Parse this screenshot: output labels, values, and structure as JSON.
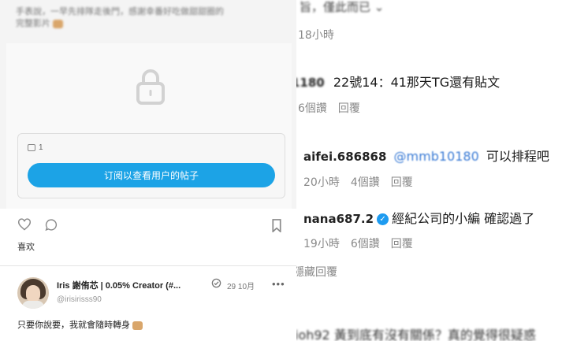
{
  "left": {
    "blurred_text": [
      "手表說，一早先排隊走後門，感謝幸番好吃做甜甜圈的",
      "完整影片"
    ],
    "subscribe": {
      "image_count": "1",
      "button_label": "订阅以查看用户的帖子"
    },
    "likes_label": "喜欢",
    "post": {
      "author": "Iris 謝侑芯 | 0.05% Creator (#...",
      "date": "29 10月",
      "handle": "@irisirisss90",
      "body": "只要你說要，我就會隨時轉身"
    }
  },
  "right": {
    "top_partial": "旨，僅此而已 ⌄",
    "top_time": "18小時",
    "comment1": {
      "user": "1180",
      "text": "22號14：41那天TG還有貼文",
      "likes": "6個讚",
      "reply": "回覆"
    },
    "comment2": {
      "user": "aifei.686868",
      "mention": "@mmb10180",
      "text": "可以排程吧",
      "time": "20小時",
      "likes": "4個讚",
      "reply": "回覆"
    },
    "comment3": {
      "user": "nana687.2",
      "text": "經紀公司的小編 確認過了",
      "time": "19小時",
      "likes": "6個讚",
      "reply": "回覆"
    },
    "hide_replies": "隱藏回覆",
    "bottom_partial": "ioh92 黃到底有沒有關係？真的覺得很疑惑"
  },
  "colors": {
    "accent": "#1ca3e6",
    "verified": "#1d9bf0",
    "mention": "#3a7bd5"
  }
}
